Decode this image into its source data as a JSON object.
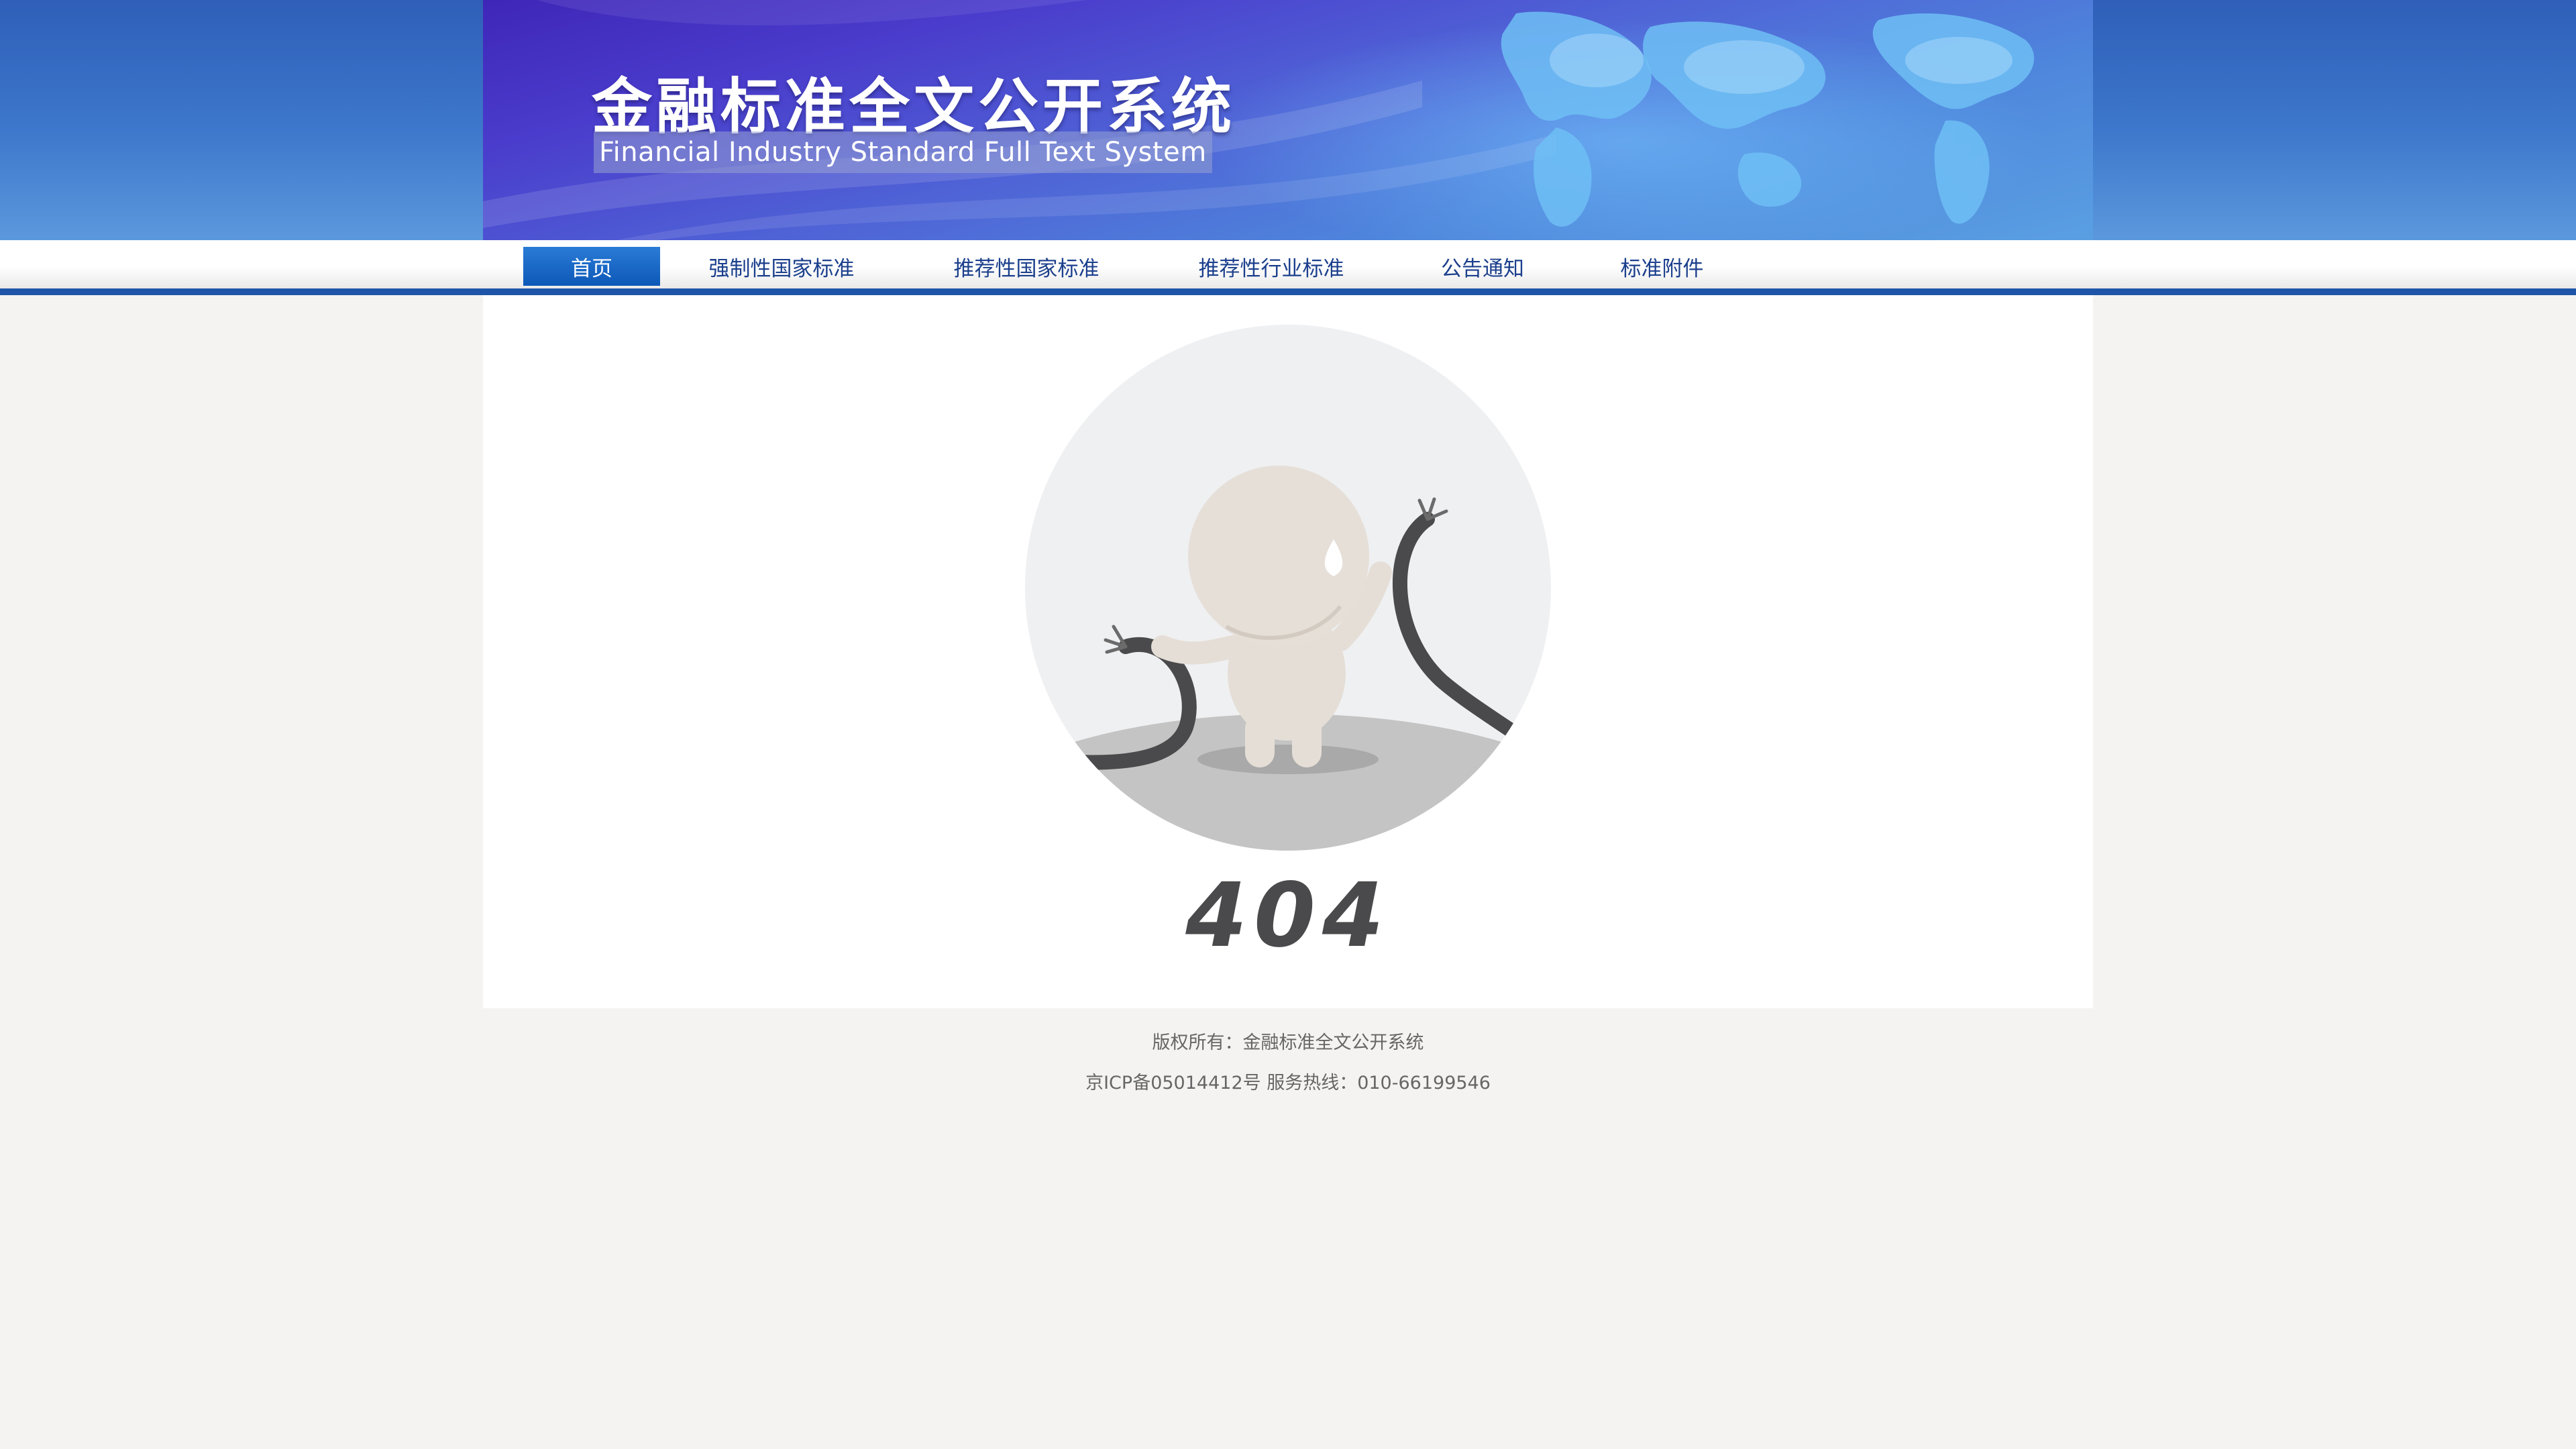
{
  "header": {
    "title_cn": "金融标准全文公开系统",
    "title_en": "Financial Industry Standard Full Text System"
  },
  "nav": {
    "items": [
      {
        "label": "首页",
        "active": true
      },
      {
        "label": "强制性国家标准",
        "active": false
      },
      {
        "label": "推荐性国家标准",
        "active": false
      },
      {
        "label": "推荐性行业标准",
        "active": false
      },
      {
        "label": "公告通知",
        "active": false
      },
      {
        "label": "标准附件",
        "active": false
      }
    ]
  },
  "error": {
    "code": "404",
    "illustration": "unplugged-cable-character-icon"
  },
  "footer": {
    "copyright": "版权所有：金融标准全文公开系统",
    "icp_and_hotline": "京ICP备05014412号 服务热线：010-66199546"
  },
  "colors": {
    "nav_accent": "#1e55a8",
    "active_tab": "#0d58b8",
    "page_bg": "#f4f3f1",
    "error_text": "#4a4a4c"
  }
}
